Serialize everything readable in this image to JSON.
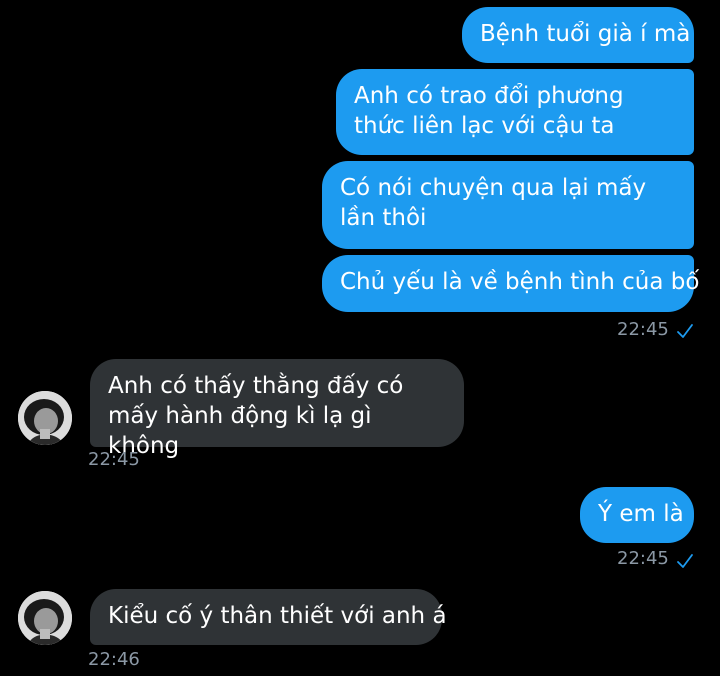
{
  "messages": [
    {
      "text": "Bệnh tuổi già í mà"
    },
    {
      "text": "Anh có trao đổi phương thức liên lạc với cậu ta"
    },
    {
      "text": "Có nói chuyện qua lại mấy lần thôi"
    },
    {
      "text": "Chủ yếu là về bệnh tình của bố"
    },
    {
      "text": "Anh có thấy thằng đấy có mấy hành động kì lạ gì không"
    },
    {
      "text": "Ý em là"
    },
    {
      "text": "Kiểu cố ý thân thiết với anh á"
    }
  ],
  "timestamps": {
    "sent_1": "22:45",
    "recv_1": "22:45",
    "sent_2": "22:45",
    "recv_2": "22:46"
  },
  "icons": {
    "read_check": "check-icon",
    "avatar": "avatar-icon"
  },
  "colors": {
    "sent_bubble": "#1d9bf0",
    "received_bubble": "#2f3336",
    "timestamp": "#8b98a5",
    "background": "#000000"
  }
}
